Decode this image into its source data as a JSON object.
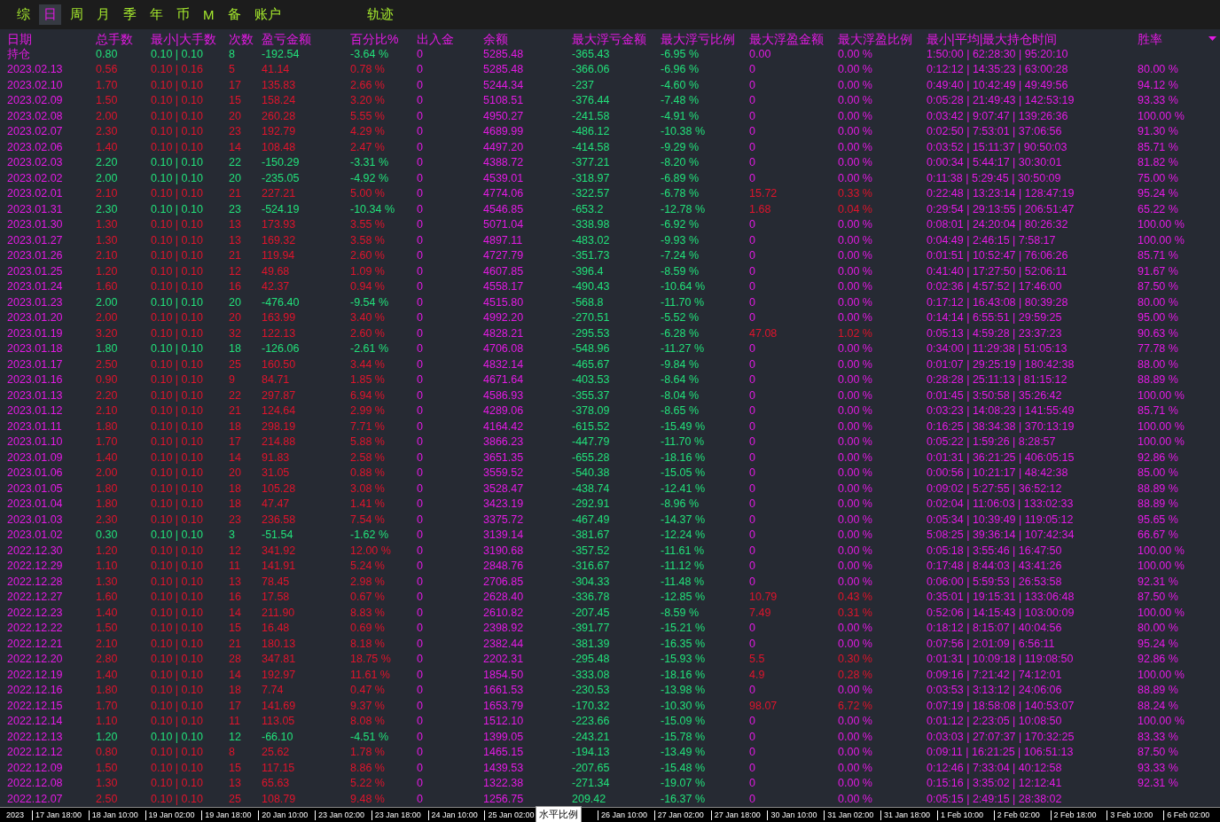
{
  "tabs": [
    {
      "label": "综",
      "selected": false
    },
    {
      "label": "日",
      "selected": true
    },
    {
      "label": "周",
      "selected": false
    },
    {
      "label": "月",
      "selected": false
    },
    {
      "label": "季",
      "selected": false
    },
    {
      "label": "年",
      "selected": false
    },
    {
      "label": "币",
      "selected": false
    },
    {
      "label": "M",
      "selected": false
    },
    {
      "label": "备",
      "selected": false
    },
    {
      "label": "账户",
      "selected": false
    }
  ],
  "trace_tab": {
    "label": "轨迹",
    "selected": false
  },
  "columns": [
    "日期",
    "总手数",
    "最小|大手数",
    "次数",
    "盈亏金额",
    "百分比%",
    "出入金",
    "余额",
    "最大浮亏金额",
    "最大浮亏比例",
    "最大浮盈金额",
    "最大浮盈比例",
    "最小|平均|最大持仓时间",
    "胜率"
  ],
  "rows": [
    {
      "cells": [
        "持仓",
        "0.80",
        "0.10 | 0.10",
        "8",
        "-192.54",
        "-3.64 %",
        "0",
        "5285.48",
        "-365.43",
        "-6.95 %",
        "0.00",
        "0.00 %",
        "1:50:00 | 62:28:30 | 95:20:10"
      ],
      "profit": false,
      "float_gain": false
    },
    {
      "cells": [
        "2023.02.13",
        "0.56",
        "0.10 | 0.16",
        "5",
        "41.14",
        "0.78 %",
        "0",
        "5285.48",
        "-366.06",
        "-6.96 %",
        "0",
        "0.00 %",
        "0:12:12 | 14:35:23 | 63:00:28",
        "80.00 %"
      ],
      "profit": true,
      "float_gain": false
    },
    {
      "cells": [
        "2023.02.10",
        "1.70",
        "0.10 | 0.10",
        "17",
        "135.83",
        "2.66 %",
        "0",
        "5244.34",
        "-237",
        "-4.60 %",
        "0",
        "0.00 %",
        "0:49:40 | 10:42:49 | 49:49:56",
        "94.12 %"
      ],
      "profit": true,
      "float_gain": false
    },
    {
      "cells": [
        "2023.02.09",
        "1.50",
        "0.10 | 0.10",
        "15",
        "158.24",
        "3.20 %",
        "0",
        "5108.51",
        "-376.44",
        "-7.48 %",
        "0",
        "0.00 %",
        "0:05:28 | 21:49:43 | 142:53:19",
        "93.33 %"
      ],
      "profit": true,
      "float_gain": false
    },
    {
      "cells": [
        "2023.02.08",
        "2.00",
        "0.10 | 0.10",
        "20",
        "260.28",
        "5.55 %",
        "0",
        "4950.27",
        "-241.58",
        "-4.91 %",
        "0",
        "0.00 %",
        "0:03:42 | 9:07:47 | 139:26:36",
        "100.00 %"
      ],
      "profit": true,
      "float_gain": false
    },
    {
      "cells": [
        "2023.02.07",
        "2.30",
        "0.10 | 0.10",
        "23",
        "192.79",
        "4.29 %",
        "0",
        "4689.99",
        "-486.12",
        "-10.38 %",
        "0",
        "0.00 %",
        "0:02:50 | 7:53:01 | 37:06:56",
        "91.30 %"
      ],
      "profit": true,
      "float_gain": false
    },
    {
      "cells": [
        "2023.02.06",
        "1.40",
        "0.10 | 0.10",
        "14",
        "108.48",
        "2.47 %",
        "0",
        "4497.20",
        "-414.58",
        "-9.29 %",
        "0",
        "0.00 %",
        "0:03:52 | 15:11:37 | 90:50:03",
        "85.71 %"
      ],
      "profit": true,
      "float_gain": false
    },
    {
      "cells": [
        "2023.02.03",
        "2.20",
        "0.10 | 0.10",
        "22",
        "-150.29",
        "-3.31 %",
        "0",
        "4388.72",
        "-377.21",
        "-8.20 %",
        "0",
        "0.00 %",
        "0:00:34 | 5:44:17 | 30:30:01",
        "81.82 %"
      ],
      "profit": false,
      "float_gain": false
    },
    {
      "cells": [
        "2023.02.02",
        "2.00",
        "0.10 | 0.10",
        "20",
        "-235.05",
        "-4.92 %",
        "0",
        "4539.01",
        "-318.97",
        "-6.89 %",
        "0",
        "0.00 %",
        "0:11:38 | 5:29:45 | 30:50:09",
        "75.00 %"
      ],
      "profit": false,
      "float_gain": false
    },
    {
      "cells": [
        "2023.02.01",
        "2.10",
        "0.10 | 0.10",
        "21",
        "227.21",
        "5.00 %",
        "0",
        "4774.06",
        "-322.57",
        "-6.78 %",
        "15.72",
        "0.33 %",
        "0:22:48 | 13:23:14 | 128:47:19",
        "95.24 %"
      ],
      "profit": true,
      "float_gain": true
    },
    {
      "cells": [
        "2023.01.31",
        "2.30",
        "0.10 | 0.10",
        "23",
        "-524.19",
        "-10.34 %",
        "0",
        "4546.85",
        "-653.2",
        "-12.78 %",
        "1.68",
        "0.04 %",
        "0:29:54 | 29:13:55 | 206:51:47",
        "65.22 %"
      ],
      "profit": false,
      "float_gain": true
    },
    {
      "cells": [
        "2023.01.30",
        "1.30",
        "0.10 | 0.10",
        "13",
        "173.93",
        "3.55 %",
        "0",
        "5071.04",
        "-338.98",
        "-6.92 %",
        "0",
        "0.00 %",
        "0:08:01 | 24:20:04 | 80:26:32",
        "100.00 %"
      ],
      "profit": true,
      "float_gain": false
    },
    {
      "cells": [
        "2023.01.27",
        "1.30",
        "0.10 | 0.10",
        "13",
        "169.32",
        "3.58 %",
        "0",
        "4897.11",
        "-483.02",
        "-9.93 %",
        "0",
        "0.00 %",
        "0:04:49 | 2:46:15 | 7:58:17",
        "100.00 %"
      ],
      "profit": true,
      "float_gain": false
    },
    {
      "cells": [
        "2023.01.26",
        "2.10",
        "0.10 | 0.10",
        "21",
        "119.94",
        "2.60 %",
        "0",
        "4727.79",
        "-351.73",
        "-7.24 %",
        "0",
        "0.00 %",
        "0:01:51 | 10:52:47 | 76:06:26",
        "85.71 %"
      ],
      "profit": true,
      "float_gain": false
    },
    {
      "cells": [
        "2023.01.25",
        "1.20",
        "0.10 | 0.10",
        "12",
        "49.68",
        "1.09 %",
        "0",
        "4607.85",
        "-396.4",
        "-8.59 %",
        "0",
        "0.00 %",
        "0:41:40 | 17:27:50 | 52:06:11",
        "91.67 %"
      ],
      "profit": true,
      "float_gain": false
    },
    {
      "cells": [
        "2023.01.24",
        "1.60",
        "0.10 | 0.10",
        "16",
        "42.37",
        "0.94 %",
        "0",
        "4558.17",
        "-490.43",
        "-10.64 %",
        "0",
        "0.00 %",
        "0:02:36 | 4:57:52 | 17:46:00",
        "87.50 %"
      ],
      "profit": true,
      "float_gain": false
    },
    {
      "cells": [
        "2023.01.23",
        "2.00",
        "0.10 | 0.10",
        "20",
        "-476.40",
        "-9.54 %",
        "0",
        "4515.80",
        "-568.8",
        "-11.70 %",
        "0",
        "0.00 %",
        "0:17:12 | 16:43:08 | 80:39:28",
        "80.00 %"
      ],
      "profit": false,
      "float_gain": false
    },
    {
      "cells": [
        "2023.01.20",
        "2.00",
        "0.10 | 0.10",
        "20",
        "163.99",
        "3.40 %",
        "0",
        "4992.20",
        "-270.51",
        "-5.52 %",
        "0",
        "0.00 %",
        "0:14:14 | 6:55:51 | 29:59:25",
        "95.00 %"
      ],
      "profit": true,
      "float_gain": false
    },
    {
      "cells": [
        "2023.01.19",
        "3.20",
        "0.10 | 0.10",
        "32",
        "122.13",
        "2.60 %",
        "0",
        "4828.21",
        "-295.53",
        "-6.28 %",
        "47.08",
        "1.02 %",
        "0:05:13 | 4:59:28 | 23:37:23",
        "90.63 %"
      ],
      "profit": true,
      "float_gain": true
    },
    {
      "cells": [
        "2023.01.18",
        "1.80",
        "0.10 | 0.10",
        "18",
        "-126.06",
        "-2.61 %",
        "0",
        "4706.08",
        "-548.96",
        "-11.27 %",
        "0",
        "0.00 %",
        "0:34:00 | 11:29:38 | 51:05:13",
        "77.78 %"
      ],
      "profit": false,
      "float_gain": false
    },
    {
      "cells": [
        "2023.01.17",
        "2.50",
        "0.10 | 0.10",
        "25",
        "160.50",
        "3.44 %",
        "0",
        "4832.14",
        "-465.67",
        "-9.84 %",
        "0",
        "0.00 %",
        "0:01:07 | 29:25:19 | 180:42:38",
        "88.00 %"
      ],
      "profit": true,
      "float_gain": false
    },
    {
      "cells": [
        "2023.01.16",
        "0.90",
        "0.10 | 0.10",
        "9",
        "84.71",
        "1.85 %",
        "0",
        "4671.64",
        "-403.53",
        "-8.64 %",
        "0",
        "0.00 %",
        "0:28:28 | 25:11:13 | 81:15:12",
        "88.89 %"
      ],
      "profit": true,
      "float_gain": false
    },
    {
      "cells": [
        "2023.01.13",
        "2.20",
        "0.10 | 0.10",
        "22",
        "297.87",
        "6.94 %",
        "0",
        "4586.93",
        "-355.37",
        "-8.04 %",
        "0",
        "0.00 %",
        "0:01:45 | 3:50:58 | 35:26:42",
        "100.00 %"
      ],
      "profit": true,
      "float_gain": false
    },
    {
      "cells": [
        "2023.01.12",
        "2.10",
        "0.10 | 0.10",
        "21",
        "124.64",
        "2.99 %",
        "0",
        "4289.06",
        "-378.09",
        "-8.65 %",
        "0",
        "0.00 %",
        "0:03:23 | 14:08:23 | 141:55:49",
        "85.71 %"
      ],
      "profit": true,
      "float_gain": false
    },
    {
      "cells": [
        "2023.01.11",
        "1.80",
        "0.10 | 0.10",
        "18",
        "298.19",
        "7.71 %",
        "0",
        "4164.42",
        "-615.52",
        "-15.49 %",
        "0",
        "0.00 %",
        "0:16:25 | 38:34:38 | 370:13:19",
        "100.00 %"
      ],
      "profit": true,
      "float_gain": false
    },
    {
      "cells": [
        "2023.01.10",
        "1.70",
        "0.10 | 0.10",
        "17",
        "214.88",
        "5.88 %",
        "0",
        "3866.23",
        "-447.79",
        "-11.70 %",
        "0",
        "0.00 %",
        "0:05:22 | 1:59:26 | 8:28:57",
        "100.00 %"
      ],
      "profit": true,
      "float_gain": false
    },
    {
      "cells": [
        "2023.01.09",
        "1.40",
        "0.10 | 0.10",
        "14",
        "91.83",
        "2.58 %",
        "0",
        "3651.35",
        "-655.28",
        "-18.16 %",
        "0",
        "0.00 %",
        "0:01:31 | 36:21:25 | 406:05:15",
        "92.86 %"
      ],
      "profit": true,
      "float_gain": false
    },
    {
      "cells": [
        "2023.01.06",
        "2.00",
        "0.10 | 0.10",
        "20",
        "31.05",
        "0.88 %",
        "0",
        "3559.52",
        "-540.38",
        "-15.05 %",
        "0",
        "0.00 %",
        "0:00:56 | 10:21:17 | 48:42:38",
        "85.00 %"
      ],
      "profit": true,
      "float_gain": false
    },
    {
      "cells": [
        "2023.01.05",
        "1.80",
        "0.10 | 0.10",
        "18",
        "105.28",
        "3.08 %",
        "0",
        "3528.47",
        "-438.74",
        "-12.41 %",
        "0",
        "0.00 %",
        "0:09:02 | 5:27:55 | 36:52:12",
        "88.89 %"
      ],
      "profit": true,
      "float_gain": false
    },
    {
      "cells": [
        "2023.01.04",
        "1.80",
        "0.10 | 0.10",
        "18",
        "47.47",
        "1.41 %",
        "0",
        "3423.19",
        "-292.91",
        "-8.96 %",
        "0",
        "0.00 %",
        "0:02:04 | 11:06:03 | 133:02:33",
        "88.89 %"
      ],
      "profit": true,
      "float_gain": false
    },
    {
      "cells": [
        "2023.01.03",
        "2.30",
        "0.10 | 0.10",
        "23",
        "236.58",
        "7.54 %",
        "0",
        "3375.72",
        "-467.49",
        "-14.37 %",
        "0",
        "0.00 %",
        "0:05:34 | 10:39:49 | 119:05:12",
        "95.65 %"
      ],
      "profit": true,
      "float_gain": false
    },
    {
      "cells": [
        "2023.01.02",
        "0.30",
        "0.10 | 0.10",
        "3",
        "-51.54",
        "-1.62 %",
        "0",
        "3139.14",
        "-381.67",
        "-12.24 %",
        "0",
        "0.00 %",
        "5:08:25 | 39:36:14 | 107:42:34",
        "66.67 %"
      ],
      "profit": false,
      "float_gain": false
    },
    {
      "cells": [
        "2022.12.30",
        "1.20",
        "0.10 | 0.10",
        "12",
        "341.92",
        "12.00 %",
        "0",
        "3190.68",
        "-357.52",
        "-11.61 %",
        "0",
        "0.00 %",
        "0:05:18 | 3:55:46 | 16:47:50",
        "100.00 %"
      ],
      "profit": true,
      "float_gain": false
    },
    {
      "cells": [
        "2022.12.29",
        "1.10",
        "0.10 | 0.10",
        "11",
        "141.91",
        "5.24 %",
        "0",
        "2848.76",
        "-316.67",
        "-11.12 %",
        "0",
        "0.00 %",
        "0:17:48 | 8:44:03 | 43:41:26",
        "100.00 %"
      ],
      "profit": true,
      "float_gain": false
    },
    {
      "cells": [
        "2022.12.28",
        "1.30",
        "0.10 | 0.10",
        "13",
        "78.45",
        "2.98 %",
        "0",
        "2706.85",
        "-304.33",
        "-11.48 %",
        "0",
        "0.00 %",
        "0:06:00 | 5:59:53 | 26:53:58",
        "92.31 %"
      ],
      "profit": true,
      "float_gain": false
    },
    {
      "cells": [
        "2022.12.27",
        "1.60",
        "0.10 | 0.10",
        "16",
        "17.58",
        "0.67 %",
        "0",
        "2628.40",
        "-336.78",
        "-12.85 %",
        "10.79",
        "0.43 %",
        "0:35:01 | 19:15:31 | 133:06:48",
        "87.50 %"
      ],
      "profit": true,
      "float_gain": true
    },
    {
      "cells": [
        "2022.12.23",
        "1.40",
        "0.10 | 0.10",
        "14",
        "211.90",
        "8.83 %",
        "0",
        "2610.82",
        "-207.45",
        "-8.59 %",
        "7.49",
        "0.31 %",
        "0:52:06 | 14:15:43 | 103:00:09",
        "100.00 %"
      ],
      "profit": true,
      "float_gain": true
    },
    {
      "cells": [
        "2022.12.22",
        "1.50",
        "0.10 | 0.10",
        "15",
        "16.48",
        "0.69 %",
        "0",
        "2398.92",
        "-391.77",
        "-15.21 %",
        "0",
        "0.00 %",
        "0:18:12 | 8:15:07 | 40:04:56",
        "80.00 %"
      ],
      "profit": true,
      "float_gain": false
    },
    {
      "cells": [
        "2022.12.21",
        "2.10",
        "0.10 | 0.10",
        "21",
        "180.13",
        "8.18 %",
        "0",
        "2382.44",
        "-381.39",
        "-16.35 %",
        "0",
        "0.00 %",
        "0:07:56 | 2:01:09 | 6:56:11",
        "95.24 %"
      ],
      "profit": true,
      "float_gain": false
    },
    {
      "cells": [
        "2022.12.20",
        "2.80",
        "0.10 | 0.10",
        "28",
        "347.81",
        "18.75 %",
        "0",
        "2202.31",
        "-295.48",
        "-15.93 %",
        "5.5",
        "0.30 %",
        "0:01:31 | 10:09:18 | 119:08:50",
        "92.86 %"
      ],
      "profit": true,
      "float_gain": true
    },
    {
      "cells": [
        "2022.12.19",
        "1.40",
        "0.10 | 0.10",
        "14",
        "192.97",
        "11.61 %",
        "0",
        "1854.50",
        "-333.08",
        "-18.16 %",
        "4.9",
        "0.28 %",
        "0:09:16 | 7:21:42 | 74:12:01",
        "100.00 %"
      ],
      "profit": true,
      "float_gain": true
    },
    {
      "cells": [
        "2022.12.16",
        "1.80",
        "0.10 | 0.10",
        "18",
        "7.74",
        "0.47 %",
        "0",
        "1661.53",
        "-230.53",
        "-13.98 %",
        "0",
        "0.00 %",
        "0:03:53 | 3:13:12 | 24:06:06",
        "88.89 %"
      ],
      "profit": true,
      "float_gain": false
    },
    {
      "cells": [
        "2022.12.15",
        "1.70",
        "0.10 | 0.10",
        "17",
        "141.69",
        "9.37 %",
        "0",
        "1653.79",
        "-170.32",
        "-10.30 %",
        "98.07",
        "6.72 %",
        "0:07:19 | 18:58:08 | 140:53:07",
        "88.24 %"
      ],
      "profit": true,
      "float_gain": true
    },
    {
      "cells": [
        "2022.12.14",
        "1.10",
        "0.10 | 0.10",
        "11",
        "113.05",
        "8.08 %",
        "0",
        "1512.10",
        "-223.66",
        "-15.09 %",
        "0",
        "0.00 %",
        "0:01:12 | 2:23:05 | 10:08:50",
        "100.00 %"
      ],
      "profit": true,
      "float_gain": false
    },
    {
      "cells": [
        "2022.12.13",
        "1.20",
        "0.10 | 0.10",
        "12",
        "-66.10",
        "-4.51 %",
        "0",
        "1399.05",
        "-243.21",
        "-15.78 %",
        "0",
        "0.00 %",
        "0:03:03 | 27:07:37 | 170:32:25",
        "83.33 %"
      ],
      "profit": false,
      "float_gain": false
    },
    {
      "cells": [
        "2022.12.12",
        "0.80",
        "0.10 | 0.10",
        "8",
        "25.62",
        "1.78 %",
        "0",
        "1465.15",
        "-194.13",
        "-13.49 %",
        "0",
        "0.00 %",
        "0:09:11 | 16:21:25 | 106:51:13",
        "87.50 %"
      ],
      "profit": true,
      "float_gain": false
    },
    {
      "cells": [
        "2022.12.09",
        "1.50",
        "0.10 | 0.10",
        "15",
        "117.15",
        "8.86 %",
        "0",
        "1439.53",
        "-207.65",
        "-15.48 %",
        "0",
        "0.00 %",
        "0:12:46 | 7:33:04 | 40:12:58",
        "93.33 %"
      ],
      "profit": true,
      "float_gain": false
    },
    {
      "cells": [
        "2022.12.08",
        "1.30",
        "0.10 | 0.10",
        "13",
        "65.63",
        "5.22 %",
        "0",
        "1322.38",
        "-271.34",
        "-19.07 %",
        "0",
        "0.00 %",
        "0:15:16 | 3:35:02 | 12:12:41",
        "92.31 %"
      ],
      "profit": true,
      "float_gain": false
    },
    {
      "cells": [
        "2022.12.07",
        "2.50",
        "0.10 | 0.10",
        "25",
        "108.79",
        "9.48 %",
        "0",
        "1256.75",
        "209.42",
        "-16.37 %",
        "0",
        "0.00 %",
        "0:05:15 | 2:49:15 | 28:38:02"
      ],
      "profit": true,
      "float_gain": false
    }
  ],
  "axis": {
    "labels_before": [
      "2023",
      "17 Jan 18:00",
      "18 Jan 10:00",
      "19 Jan 02:00",
      "19 Jan 18:00",
      "20 Jan 10:00",
      "23 Jan 02:00",
      "23 Jan 18:00",
      "24 Jan 10:00",
      "25 Jan 02:00"
    ],
    "tooltip": "水平比例",
    "labels_after": [
      "26 Jan 10:00",
      "27 Jan 02:00",
      "27 Jan 18:00",
      "30 Jan 10:00",
      "31 Jan 02:00",
      "31 Jan 18:00",
      "1 Feb 10:00",
      "2 Feb 02:00",
      "2 Feb 18:00",
      "3 Feb 10:00",
      "6 Feb 02:00"
    ]
  }
}
